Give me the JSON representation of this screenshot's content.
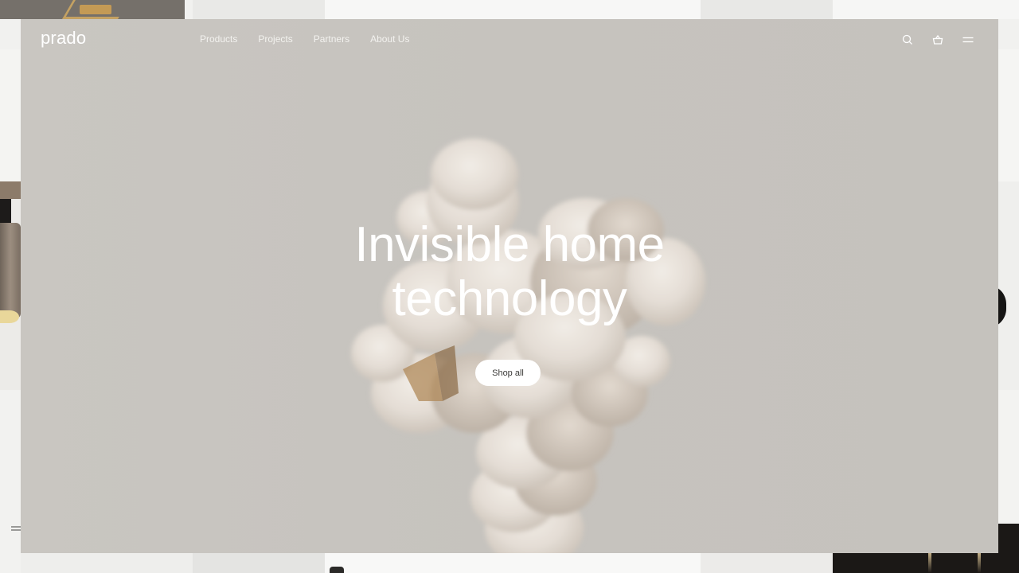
{
  "brand": {
    "logo": "prado"
  },
  "nav": {
    "items": [
      {
        "label": "Products"
      },
      {
        "label": "Projects"
      },
      {
        "label": "Partners"
      },
      {
        "label": "About Us"
      }
    ],
    "icons": [
      "search-icon",
      "basket-icon",
      "menu-icon"
    ]
  },
  "hero": {
    "headline_line1": "Invisible home",
    "headline_line2": "technology",
    "cta_label": "Shop all",
    "background": "#c7c4bf",
    "smoke_color": "#e8e1da"
  }
}
